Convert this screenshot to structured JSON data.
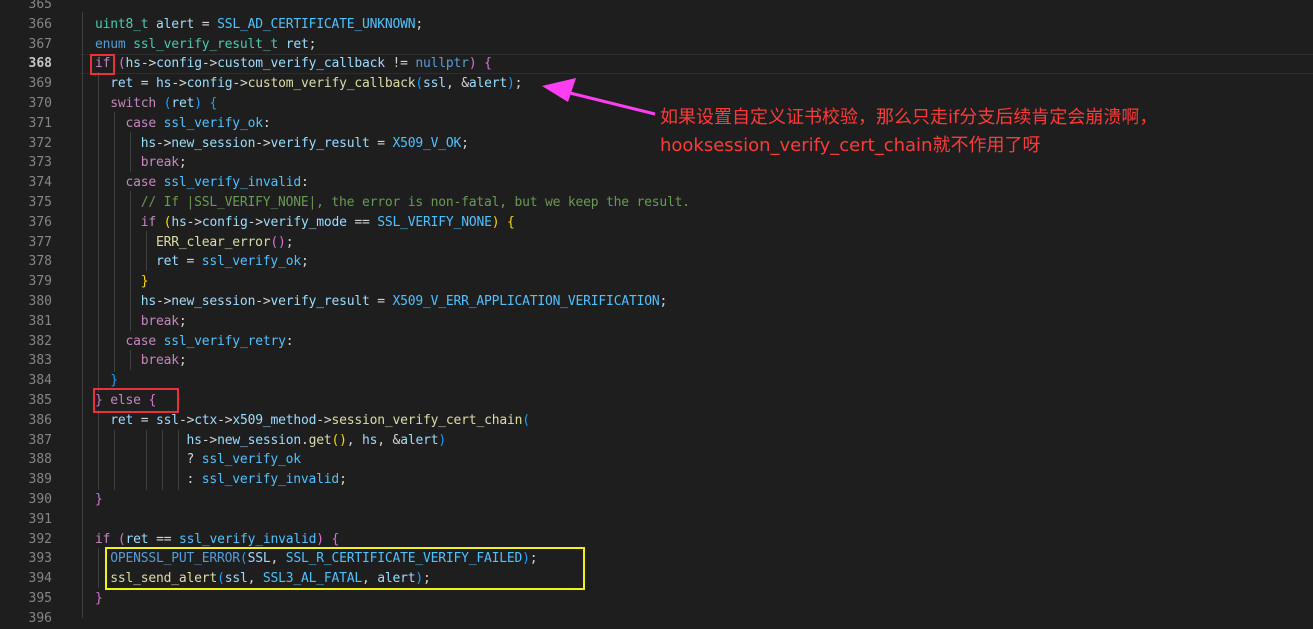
{
  "editor": {
    "active_line": "368",
    "lines": [
      {
        "n": "365",
        "html": ""
      },
      {
        "n": "366",
        "html": "<span class='t-type'>uint8_t</span> <span class='t-var'>alert</span> = <span class='t-const'>SSL_AD_CERTIFICATE_UNKNOWN</span>;"
      },
      {
        "n": "367",
        "html": "<span class='t-kw'>enum</span> <span class='t-type'>ssl_verify_result_t</span> <span class='t-var'>ret</span>;"
      },
      {
        "n": "368",
        "html": "<span class='t-ctl'>if</span> <span class='t-br2'>(</span><span class='t-var'>hs</span>-&gt;<span class='t-var'>config</span>-&gt;<span class='t-var'>custom_verify_callback</span> != <span class='t-kw'>nullptr</span><span class='t-br2'>)</span> <span class='t-br2'>{</span>"
      },
      {
        "n": "369",
        "html": "  <span class='t-var'>ret</span> = <span class='t-var'>hs</span>-&gt;<span class='t-var'>config</span>-&gt;<span class='t-fn'>custom_verify_callback</span><span class='t-br3'>(</span><span class='t-var'>ssl</span>, &amp;<span class='t-var'>alert</span><span class='t-br3'>)</span>;"
      },
      {
        "n": "370",
        "html": "  <span class='t-ctl'>switch</span> <span class='t-br3'>(</span><span class='t-var'>ret</span><span class='t-br3'>)</span> <span class='t-br3'>{</span>"
      },
      {
        "n": "371",
        "html": "    <span class='t-ctl'>case</span> <span class='t-const'>ssl_verify_ok</span>:"
      },
      {
        "n": "372",
        "html": "      <span class='t-var'>hs</span>-&gt;<span class='t-var'>new_session</span>-&gt;<span class='t-var'>verify_result</span> = <span class='t-const'>X509_V_OK</span>;"
      },
      {
        "n": "373",
        "html": "      <span class='t-ctl'>break</span>;"
      },
      {
        "n": "374",
        "html": "    <span class='t-ctl'>case</span> <span class='t-const'>ssl_verify_invalid</span>:"
      },
      {
        "n": "375",
        "html": "      <span class='t-cm'>// If |SSL_VERIFY_NONE|, the error is non-fatal, but we keep the result.</span>"
      },
      {
        "n": "376",
        "html": "      <span class='t-ctl'>if</span> <span class='t-br1'>(</span><span class='t-var'>hs</span>-&gt;<span class='t-var'>config</span>-&gt;<span class='t-var'>verify_mode</span> == <span class='t-const'>SSL_VERIFY_NONE</span><span class='t-br1'>)</span> <span class='t-br1'>{</span>"
      },
      {
        "n": "377",
        "html": "        <span class='t-fn'>ERR_clear_error</span><span class='t-br2'>()</span>;"
      },
      {
        "n": "378",
        "html": "        <span class='t-var'>ret</span> = <span class='t-const'>ssl_verify_ok</span>;"
      },
      {
        "n": "379",
        "html": "      <span class='t-br1'>}</span>"
      },
      {
        "n": "380",
        "html": "      <span class='t-var'>hs</span>-&gt;<span class='t-var'>new_session</span>-&gt;<span class='t-var'>verify_result</span> = <span class='t-const'>X509_V_ERR_APPLICATION_VERIFICATION</span>;"
      },
      {
        "n": "381",
        "html": "      <span class='t-ctl'>break</span>;"
      },
      {
        "n": "382",
        "html": "    <span class='t-ctl'>case</span> <span class='t-const'>ssl_verify_retry</span>:"
      },
      {
        "n": "383",
        "html": "      <span class='t-ctl'>break</span>;"
      },
      {
        "n": "384",
        "html": "  <span class='t-br3'>}</span>"
      },
      {
        "n": "385",
        "html": "<span class='t-br2'>}</span> <span class='t-ctl'>else</span> <span class='t-br2'>{</span>"
      },
      {
        "n": "386",
        "html": "  <span class='t-var'>ret</span> = <span class='t-var'>ssl</span>-&gt;<span class='t-var'>ctx</span>-&gt;<span class='t-var'>x509_method</span>-&gt;<span class='t-fn'>session_verify_cert_chain</span><span class='t-br3'>(</span>"
      },
      {
        "n": "387",
        "html": "            <span class='t-var'>hs</span>-&gt;<span class='t-var'>new_session</span>.<span class='t-fn'>get</span><span class='t-br1'>()</span>, <span class='t-var'>hs</span>, &amp;<span class='t-var'>alert</span><span class='t-br3'>)</span>"
      },
      {
        "n": "388",
        "html": "            ? <span class='t-const'>ssl_verify_ok</span>"
      },
      {
        "n": "389",
        "html": "            : <span class='t-const'>ssl_verify_invalid</span>;"
      },
      {
        "n": "390",
        "html": "<span class='t-br2'>}</span>"
      },
      {
        "n": "391",
        "html": ""
      },
      {
        "n": "392",
        "html": "<span class='t-ctl'>if</span> <span class='t-br2'>(</span><span class='t-var'>ret</span> == <span class='t-const'>ssl_verify_invalid</span><span class='t-br2'>)</span> <span class='t-br2'>{</span>"
      },
      {
        "n": "393",
        "html": "  <span class='t-macro'>OPENSSL_PUT_ERROR</span><span class='t-br3'>(</span><span class='t-var'>SSL</span>, <span class='t-const'>SSL_R_CERTIFICATE_VERIFY_FAILED</span><span class='t-br3'>)</span>;"
      },
      {
        "n": "394",
        "html": "  <span class='t-fn'>ssl_send_alert</span><span class='t-br3'>(</span><span class='t-var'>ssl</span>, <span class='t-const'>SSL3_AL_FATAL</span>, <span class='t-var'>alert</span><span class='t-br3'>)</span>;"
      },
      {
        "n": "395",
        "html": "<span class='t-br2'>}</span>"
      },
      {
        "n": "396",
        "html": ""
      }
    ]
  },
  "annotation": {
    "note_line1": "如果设置自定义证书校验，那么只走if分支后续肯定会崩溃啊，",
    "note_line2": "hooksession_verify_cert_chain就不作用了呀",
    "arrow_color": "#ff3ef2",
    "box_red_color": "#e8333a",
    "box_yellow_color": "#f4f215"
  }
}
